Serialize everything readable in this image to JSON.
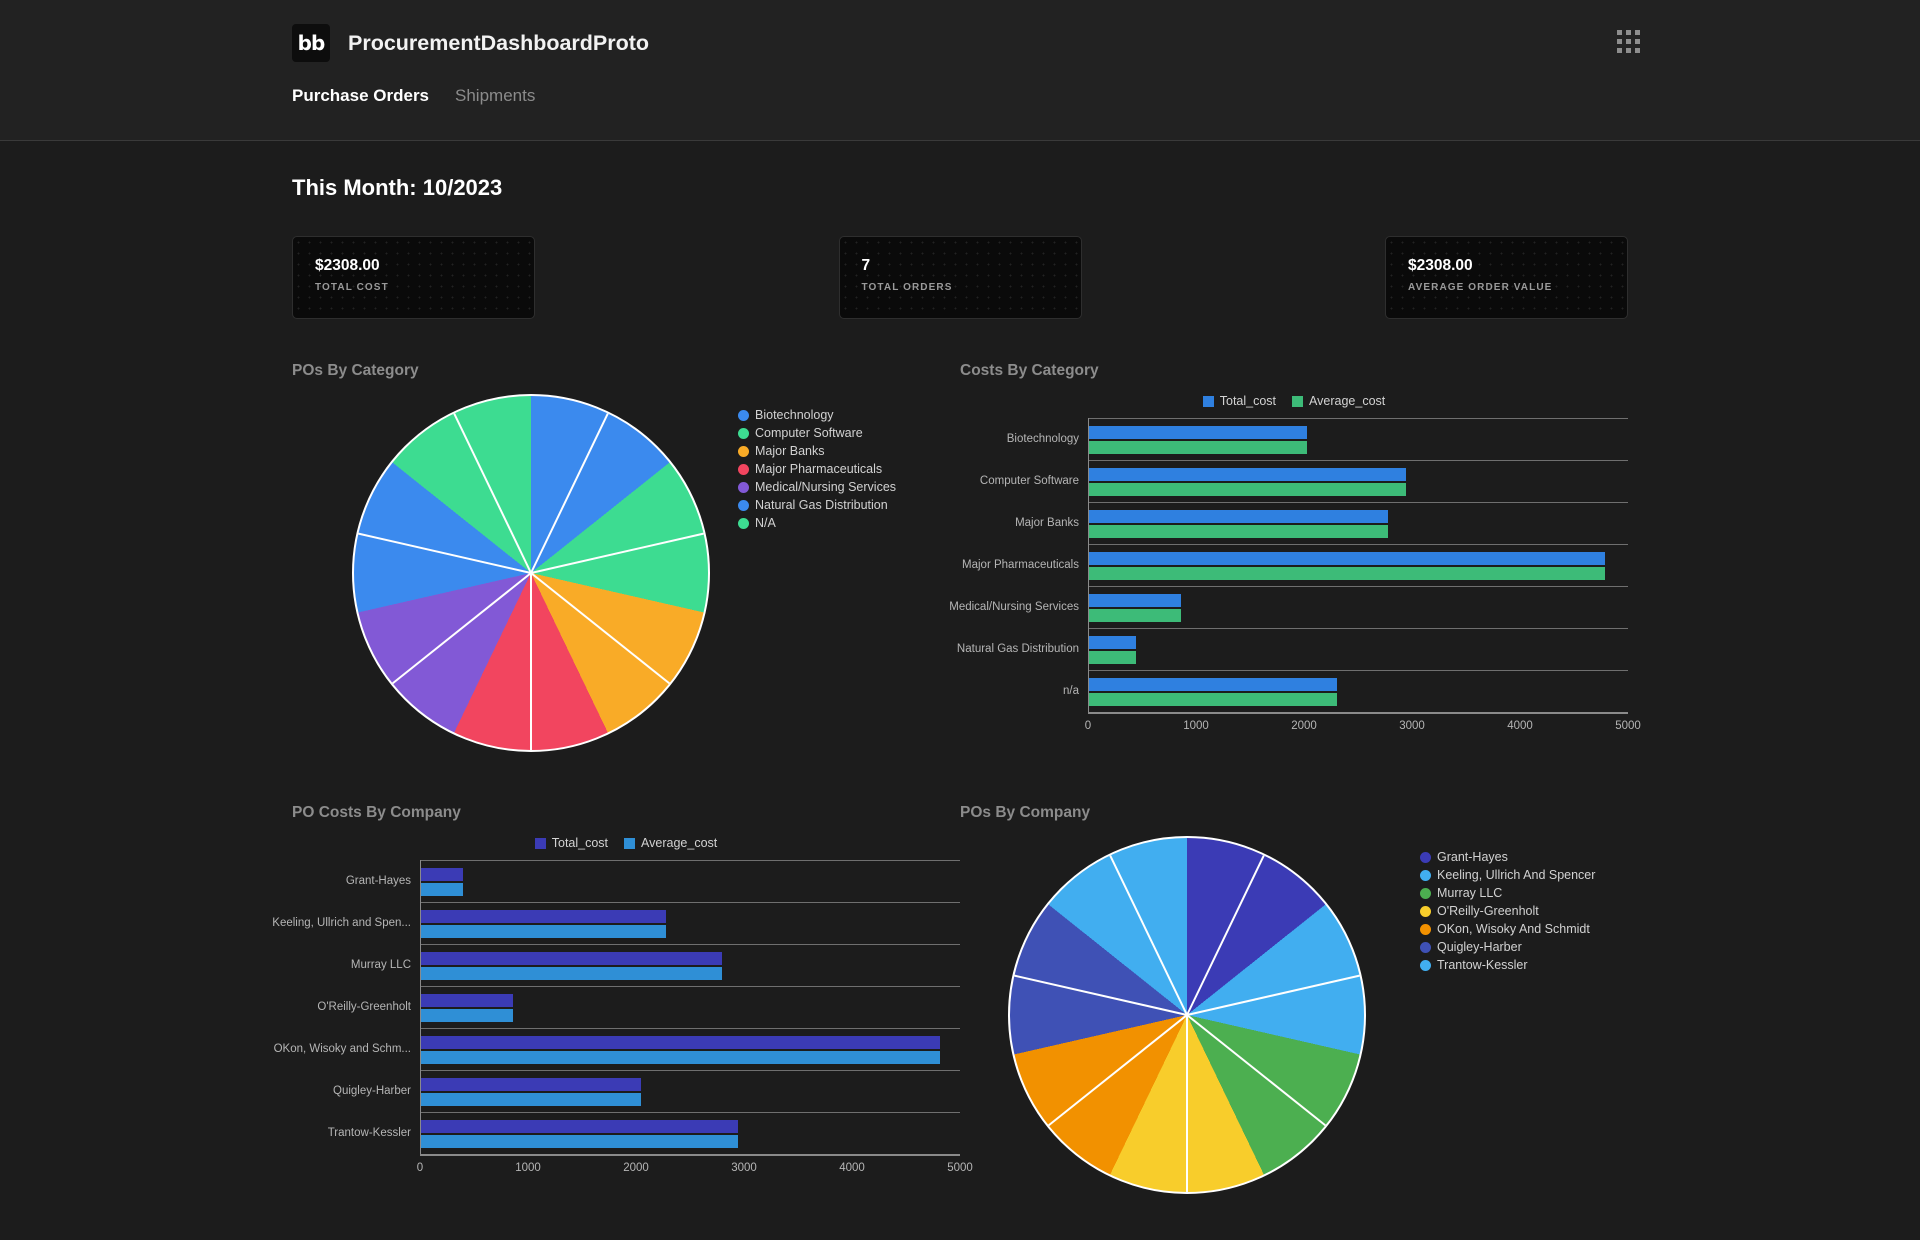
{
  "header": {
    "logo_text": "bb",
    "app_title": "ProcurementDashboardProto",
    "apps_icon": "grid-apps-icon",
    "tabs": [
      {
        "label": "Purchase Orders",
        "active": true
      },
      {
        "label": "Shipments",
        "active": false
      }
    ]
  },
  "main": {
    "month_title": "This Month: 10/2023",
    "stats": [
      {
        "value": "$2308.00",
        "label": "TOTAL COST"
      },
      {
        "value": "7",
        "label": "TOTAL ORDERS"
      },
      {
        "value": "$2308.00",
        "label": "AVERAGE ORDER VALUE"
      }
    ]
  },
  "chart_data": [
    {
      "type": "pie",
      "title": "POs By Category",
      "legend_position": "right",
      "categories": [
        "Biotechnology",
        "Computer Software",
        "Major Banks",
        "Major Pharmaceuticals",
        "Medical/Nursing Services",
        "Natural Gas Distribution",
        "N/A"
      ],
      "values": [
        1,
        1,
        1,
        1,
        1,
        1,
        1
      ],
      "colors": [
        "#3b8aee",
        "#3ddc91",
        "#f9ab27",
        "#f2455f",
        "#8259d6",
        "#3b8aee",
        "#3ddc91"
      ]
    },
    {
      "type": "bar",
      "title": "Costs By Category",
      "orientation": "horizontal",
      "legend_position": "top-right",
      "categories": [
        "Biotechnology",
        "Computer Software",
        "Major Banks",
        "Major Pharmaceuticals",
        "Medical/Nursing Services",
        "Natural Gas Distribution",
        "n/a"
      ],
      "series": [
        {
          "name": "Total_cost",
          "color": "#2f80e0",
          "values": [
            2024,
            2936,
            2778,
            4788,
            858,
            438,
            2303
          ]
        },
        {
          "name": "Average_cost",
          "color": "#3dbb78",
          "values": [
            2024,
            2936,
            2778,
            4788,
            858,
            438,
            2303
          ]
        }
      ],
      "xlim": [
        0,
        5000
      ],
      "xticks": [
        0,
        1000,
        2000,
        3000,
        4000,
        5000
      ],
      "grid": true
    },
    {
      "type": "bar",
      "title": "PO Costs By Company",
      "orientation": "horizontal",
      "legend_position": "top-right",
      "categories": [
        "Grant-Hayes",
        "Keeling, Ullrich and Spen...",
        "Murray LLC",
        "O'Reilly-Greenholt",
        "OKon, Wisoky and Schm...",
        "Quigley-Harber",
        "Trantow-Kessler"
      ],
      "series": [
        {
          "name": "Total_cost",
          "color": "#3b3bb5",
          "values": [
            393,
            2277,
            2790,
            855,
            4815,
            2042,
            2943
          ]
        },
        {
          "name": "Average_cost",
          "color": "#2f8fd6",
          "values": [
            393,
            2277,
            2790,
            855,
            4815,
            2042,
            2943
          ]
        }
      ],
      "xlim": [
        0,
        5000
      ],
      "xticks": [
        0,
        1000,
        2000,
        3000,
        4000,
        5000
      ],
      "grid": true
    },
    {
      "type": "pie",
      "title": "POs By Company",
      "legend_position": "right",
      "categories": [
        "Grant-Hayes",
        "Keeling, Ullrich And Spencer",
        "Murray LLC",
        "O'Reilly-Greenholt",
        "OKon, Wisoky And Schmidt",
        "Quigley-Harber",
        "Trantow-Kessler"
      ],
      "values": [
        1,
        1,
        1,
        1,
        1,
        1,
        1
      ],
      "colors": [
        "#3b3bb5",
        "#41aef0",
        "#4caf50",
        "#f8cd2b",
        "#f29100",
        "#3f51b5",
        "#41aef0"
      ]
    }
  ]
}
